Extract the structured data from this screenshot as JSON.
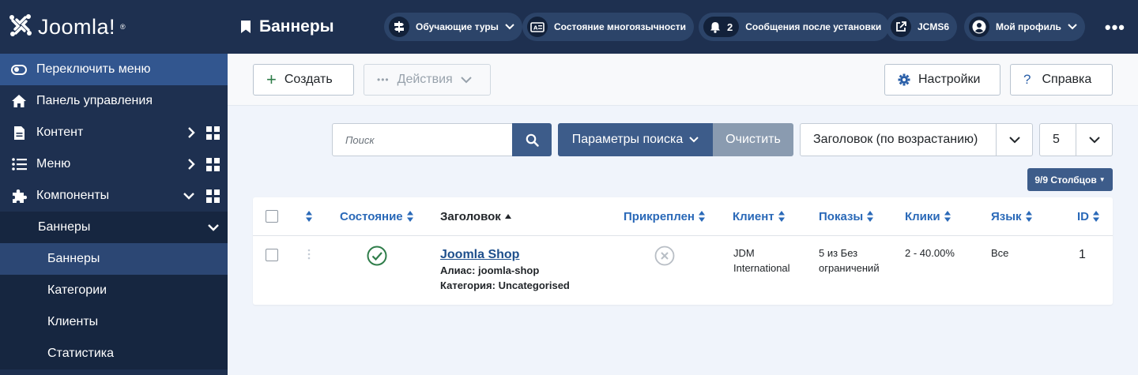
{
  "brand": {
    "name": "Joomla!"
  },
  "sidebar": {
    "toggle_label": "Переключить меню",
    "items": [
      {
        "label": "Панель управления"
      },
      {
        "label": "Контент"
      },
      {
        "label": "Меню"
      },
      {
        "label": "Компоненты"
      }
    ],
    "banners_group": "Баннеры",
    "sub_items": [
      {
        "label": "Баннеры"
      },
      {
        "label": "Категории"
      },
      {
        "label": "Клиенты"
      },
      {
        "label": "Статистика"
      }
    ]
  },
  "header": {
    "title": "Баннеры",
    "tours": "Обучающие туры",
    "multilang": "Состояние многоязычности",
    "notifications_count": "2",
    "post_install": "Сообщения после установки",
    "site": "JCMS6",
    "profile": "Мой профиль"
  },
  "toolbar": {
    "new_label": "Создать",
    "actions_label": "Действия",
    "options_label": "Настройки",
    "help_label": "Справка"
  },
  "filters": {
    "search_placeholder": "Поиск",
    "search_options": "Параметры поиска",
    "clear": "Очистить",
    "ordering": "Заголовок (по возрастанию)",
    "limit": "5",
    "columns": "9/9 Столбцов"
  },
  "table": {
    "headers": {
      "status": "Состояние",
      "title": "Заголовок",
      "sticky": "Прикреплен",
      "client": "Клиент",
      "impressions": "Показы",
      "clicks": "Клики",
      "language": "Язык",
      "id": "ID"
    },
    "rows": [
      {
        "title": "Joomla Shop",
        "alias": "Алиас: joomla-shop",
        "category": "Категория: Uncategorised",
        "client_line1": "JDM",
        "client_line2": "International",
        "impressions_line1": "5 из Без",
        "impressions_line2": "ограничений",
        "clicks": "2 - 40.00%",
        "language": "Все",
        "id": "1"
      }
    ]
  },
  "colors": {
    "sidebar": "#1e3050",
    "accent": "#3d5c8a",
    "link": "#2a69b8",
    "published": "#2f7d4a"
  }
}
